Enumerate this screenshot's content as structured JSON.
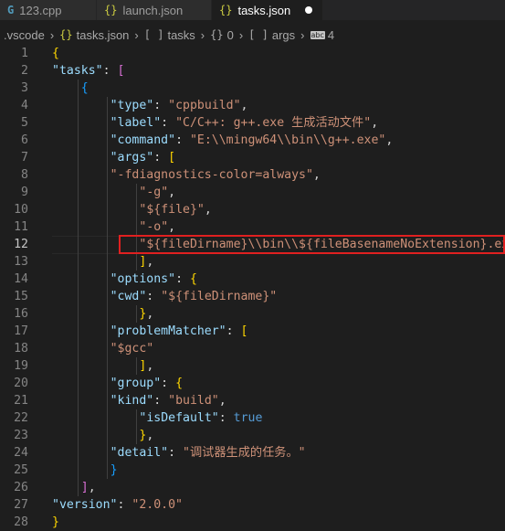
{
  "tabs": [
    {
      "label": "123.cpp",
      "icon": "cpp-file-icon",
      "icon_glyph": "G",
      "active": false
    },
    {
      "label": "launch.json",
      "icon": "json-file-icon",
      "icon_glyph": "{}",
      "active": false
    },
    {
      "label": "tasks.json",
      "icon": "json-file-icon",
      "icon_glyph": "{}",
      "active": true,
      "dirty": true
    }
  ],
  "breadcrumb": {
    "folder": ".vscode",
    "file_icon": "{}",
    "file": "tasks.json",
    "array_icon": "[ ]",
    "tasks": "tasks",
    "obj_icon": "{}",
    "index": "0",
    "args_icon": "[ ]",
    "args": "args",
    "string_icon": "abc",
    "item": "4"
  },
  "editor": {
    "current_line": 12,
    "lines": [
      {
        "n": "1",
        "text": "{"
      },
      {
        "n": "2",
        "text": "\"tasks\": ["
      },
      {
        "n": "3",
        "text": "{"
      },
      {
        "n": "4",
        "text": "\"type\": \"cppbuild\","
      },
      {
        "n": "5",
        "text": "\"label\": \"C/C++: g++.exe 生成活动文件\","
      },
      {
        "n": "6",
        "text": "\"command\": \"E:\\\\mingw64\\\\bin\\\\g++.exe\","
      },
      {
        "n": "7",
        "text": "\"args\": ["
      },
      {
        "n": "8",
        "text": "\"-fdiagnostics-color=always\","
      },
      {
        "n": "9",
        "text": "\"-g\","
      },
      {
        "n": "10",
        "text": "\"${file}\","
      },
      {
        "n": "11",
        "text": "\"-o\","
      },
      {
        "n": "12",
        "text": "\"${fileDirname}\\\\bin\\\\${fileBasenameNoExtension}.exe\""
      },
      {
        "n": "13",
        "text": "],"
      },
      {
        "n": "14",
        "text": "\"options\": {"
      },
      {
        "n": "15",
        "text": "\"cwd\": \"${fileDirname}\""
      },
      {
        "n": "16",
        "text": "},"
      },
      {
        "n": "17",
        "text": "\"problemMatcher\": ["
      },
      {
        "n": "18",
        "text": "\"$gcc\""
      },
      {
        "n": "19",
        "text": "],"
      },
      {
        "n": "20",
        "text": "\"group\": {"
      },
      {
        "n": "21",
        "text": "\"kind\": \"build\","
      },
      {
        "n": "22",
        "text": "\"isDefault\": true"
      },
      {
        "n": "23",
        "text": "},"
      },
      {
        "n": "24",
        "text": "\"detail\": \"调试器生成的任务。\""
      },
      {
        "n": "25",
        "text": "}"
      },
      {
        "n": "26",
        "text": "],"
      },
      {
        "n": "27",
        "text": "\"version\": \"2.0.0\""
      },
      {
        "n": "28",
        "text": "}"
      }
    ]
  },
  "colors": {
    "background": "#1e1e1e",
    "key": "#9cdcfe",
    "string": "#ce9178",
    "bracket_level1": "#ffd700",
    "bracket_level2": "#da70d6",
    "bracket_level3": "#179fff",
    "keyword": "#569cd6",
    "highlight_border": "#e02020"
  }
}
